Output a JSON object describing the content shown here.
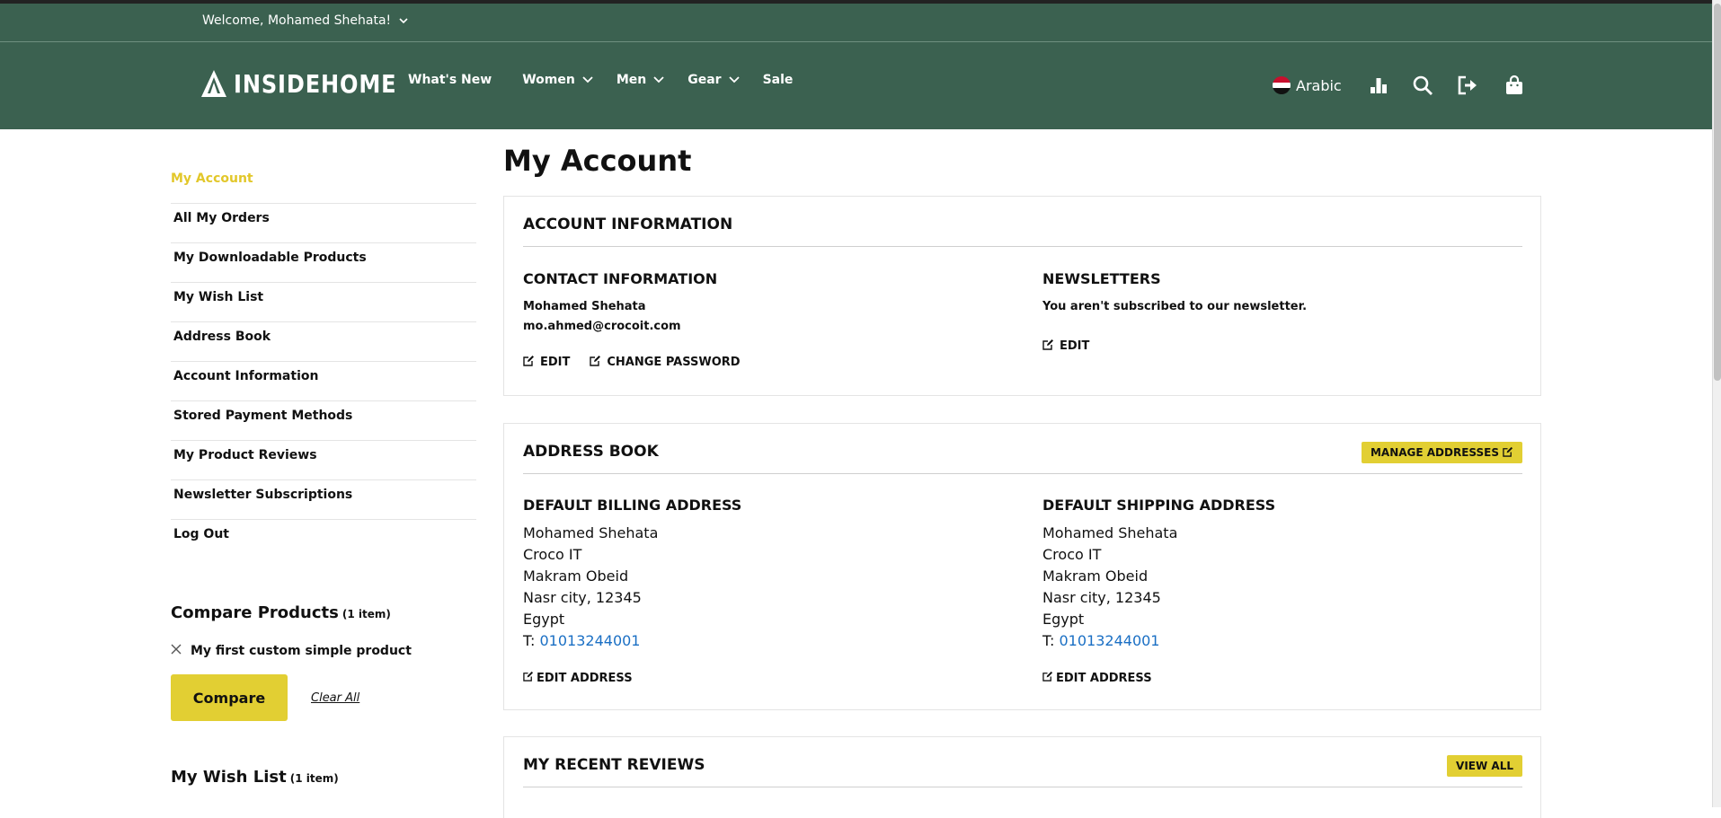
{
  "welcome_bar": {
    "text": "Welcome, Mohamed Shehata!"
  },
  "header": {
    "logo_text": "INSIDEHOME",
    "nav": [
      {
        "label": "What's New",
        "dropdown": false
      },
      {
        "label": "Women",
        "dropdown": true
      },
      {
        "label": "Men",
        "dropdown": true
      },
      {
        "label": "Gear",
        "dropdown": true
      },
      {
        "label": "Sale",
        "dropdown": false
      }
    ],
    "language": "Arabic",
    "icons": [
      "compare-chart-icon",
      "search-icon",
      "logout-icon",
      "cart-bag-icon"
    ]
  },
  "sidebar": {
    "items": [
      {
        "label": "My Account",
        "active": true
      },
      {
        "label": "All My Orders"
      },
      {
        "label": "My Downloadable Products"
      },
      {
        "label": "My Wish List"
      },
      {
        "label": "Address Book"
      },
      {
        "label": "Account Information"
      },
      {
        "label": "Stored Payment Methods"
      },
      {
        "label": "My Product Reviews"
      },
      {
        "label": "Newsletter Subscriptions"
      },
      {
        "label": "Log Out"
      }
    ],
    "compare": {
      "title": "Compare Products",
      "count": "(1 item)",
      "product": "My first custom simple product",
      "compare_button": "Compare",
      "clear_link": "Clear All"
    },
    "wishlist": {
      "title": "My Wish List",
      "count": "(1 item)"
    }
  },
  "main": {
    "page_title": "My Account",
    "account_info": {
      "title": "ACCOUNT INFORMATION",
      "contact": {
        "title": "CONTACT INFORMATION",
        "name": "Mohamed Shehata",
        "email": "mo.ahmed@crocoit.com",
        "edit": "EDIT",
        "change_password": "CHANGE PASSWORD"
      },
      "newsletters": {
        "title": "NEWSLETTERS",
        "text": "You aren't subscribed to our newsletter.",
        "edit": "EDIT"
      }
    },
    "address_book": {
      "title": "ADDRESS BOOK",
      "manage_button": "MANAGE ADDRESSES",
      "billing": {
        "title": "DEFAULT BILLING ADDRESS",
        "lines": [
          "Mohamed Shehata",
          "Croco IT",
          "Makram Obeid",
          "Nasr city, 12345",
          "Egypt"
        ],
        "phone_prefix": "T:",
        "phone": "01013244001",
        "edit": "EDIT ADDRESS"
      },
      "shipping": {
        "title": "DEFAULT SHIPPING ADDRESS",
        "lines": [
          "Mohamed Shehata",
          "Croco IT",
          "Makram Obeid",
          "Nasr city, 12345",
          "Egypt"
        ],
        "phone_prefix": "T:",
        "phone": "01013244001",
        "edit": "EDIT ADDRESS"
      }
    },
    "reviews": {
      "title": "MY RECENT REVIEWS",
      "view_all": "VIEW ALL"
    }
  },
  "colors": {
    "header_bg": "#3b6150",
    "accent_yellow": "#e2cf33",
    "active_link": "#e2c72a",
    "phone_link": "#1a6fc4"
  }
}
